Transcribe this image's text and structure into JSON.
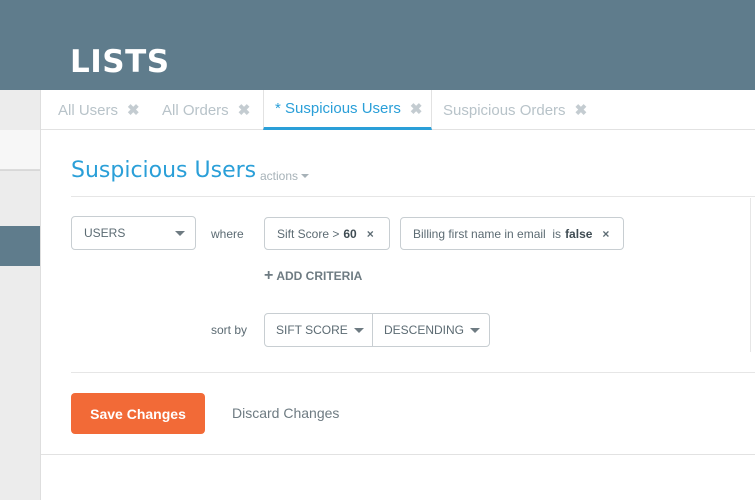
{
  "header": {
    "title": "LISTS"
  },
  "tabs": [
    {
      "label": "All Users",
      "close": "✖"
    },
    {
      "label": "All Orders",
      "close": "✖"
    },
    {
      "label": "* Suspicious Users",
      "close": "✖"
    },
    {
      "label": "Suspicious Orders",
      "close": "✖"
    }
  ],
  "list": {
    "title": "Suspicious Users",
    "actions_label": "actions"
  },
  "query": {
    "entity": "USERS",
    "where_label": "where",
    "criteria": [
      {
        "text": "Sift Score >",
        "value": "60",
        "close": "×"
      },
      {
        "text": "Billing first name in email  is",
        "value": "false",
        "close": "×"
      }
    ],
    "add_criteria": "ADD CRITERIA",
    "add_icon": "+",
    "sort_label": "sort by",
    "sort_field": "SIFT SCORE",
    "sort_order": "DESCENDING"
  },
  "footer": {
    "save_label": "Save Changes",
    "discard_label": "Discard Changes"
  },
  "colors": {
    "header": "#5f7c8c",
    "accent": "#2a9fd8",
    "save": "#f26a37"
  }
}
